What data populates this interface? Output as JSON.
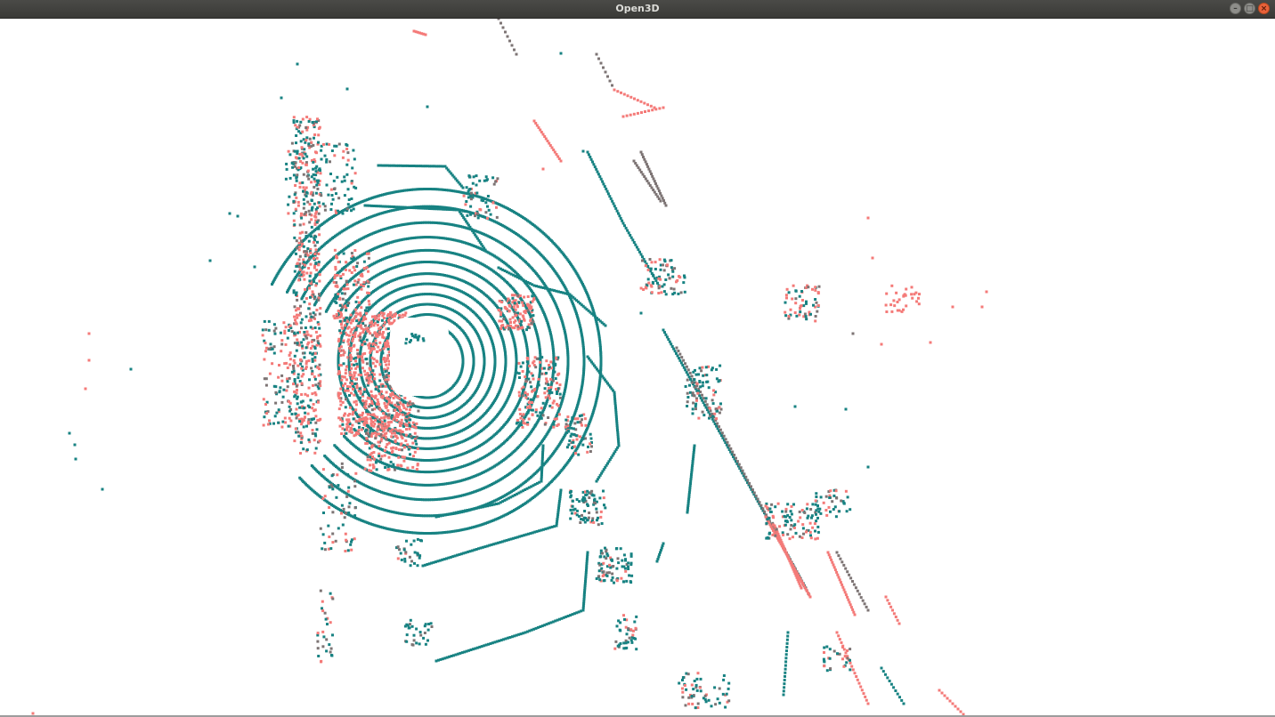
{
  "window": {
    "title": "Open3D",
    "controls": {
      "minimize_icon": "minimize-icon",
      "maximize_icon": "maximize-icon",
      "close_icon": "close-icon"
    }
  },
  "viewer": {
    "background": "#ffffff",
    "point_colors": {
      "ground": "#178282",
      "object": "#f47a78",
      "mixed": "#7d7474"
    }
  }
}
